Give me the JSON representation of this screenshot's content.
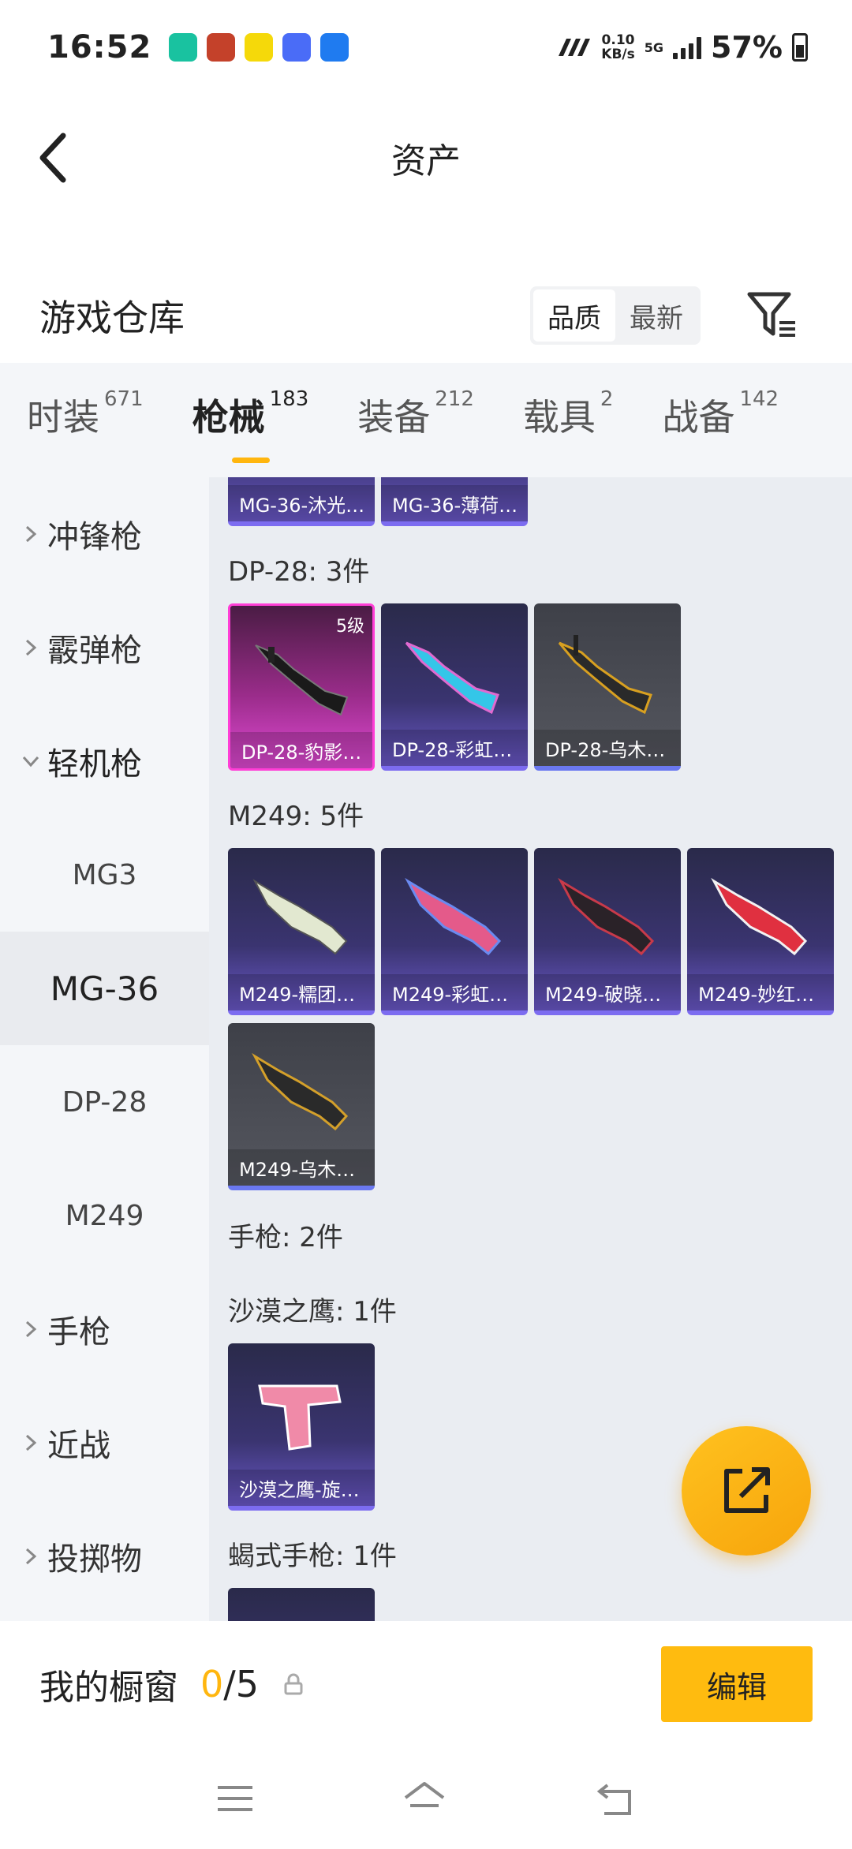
{
  "status": {
    "time": "16:52",
    "net_speed": "0.10",
    "net_unit": "KB/s",
    "network": "5G",
    "battery": "57%"
  },
  "nav": {
    "title": "资产"
  },
  "warehouse": {
    "title": "游戏仓库",
    "sort_quality": "品质",
    "sort_newest": "最新"
  },
  "tabs": [
    {
      "label": "时装",
      "count": "671"
    },
    {
      "label": "枪械",
      "count": "183"
    },
    {
      "label": "装备",
      "count": "212"
    },
    {
      "label": "载具",
      "count": "2"
    },
    {
      "label": "战备",
      "count": "142"
    }
  ],
  "sidebar": {
    "items": [
      {
        "label": "冲锋枪"
      },
      {
        "label": "霰弹枪"
      },
      {
        "label": "轻机枪"
      },
      {
        "label": "MG3"
      },
      {
        "label": "MG-36"
      },
      {
        "label": "DP-28"
      },
      {
        "label": "M249"
      },
      {
        "label": "手枪"
      },
      {
        "label": "近战"
      },
      {
        "label": "投掷物"
      }
    ]
  },
  "content": {
    "top_cards": [
      "MG-36-沐光…",
      "MG-36-薄荷…"
    ],
    "dp28_title": "DP-28: 3件",
    "dp28_cards": [
      {
        "name": "DP-28-豹影…",
        "level": "5级"
      },
      {
        "name": "DP-28-彩虹…"
      },
      {
        "name": "DP-28-乌木…"
      }
    ],
    "m249_title": "M249: 5件",
    "m249_cards": [
      {
        "name": "M249-糯团…"
      },
      {
        "name": "M249-彩虹…"
      },
      {
        "name": "M249-破晓…"
      },
      {
        "name": "M249-妙红…"
      },
      {
        "name": "M249-乌木…"
      }
    ],
    "pistol_title": "手枪: 2件",
    "deagle_title": "沙漠之鹰: 1件",
    "deagle_cards": [
      {
        "name": "沙漠之鹰-旋…"
      }
    ],
    "scorpion_title": "蝎式手枪: 1件"
  },
  "showcase": {
    "title": "我的橱窗",
    "current": "0",
    "total": "/5",
    "edit": "编辑"
  },
  "colors": {
    "accent": "#ffb60f"
  }
}
